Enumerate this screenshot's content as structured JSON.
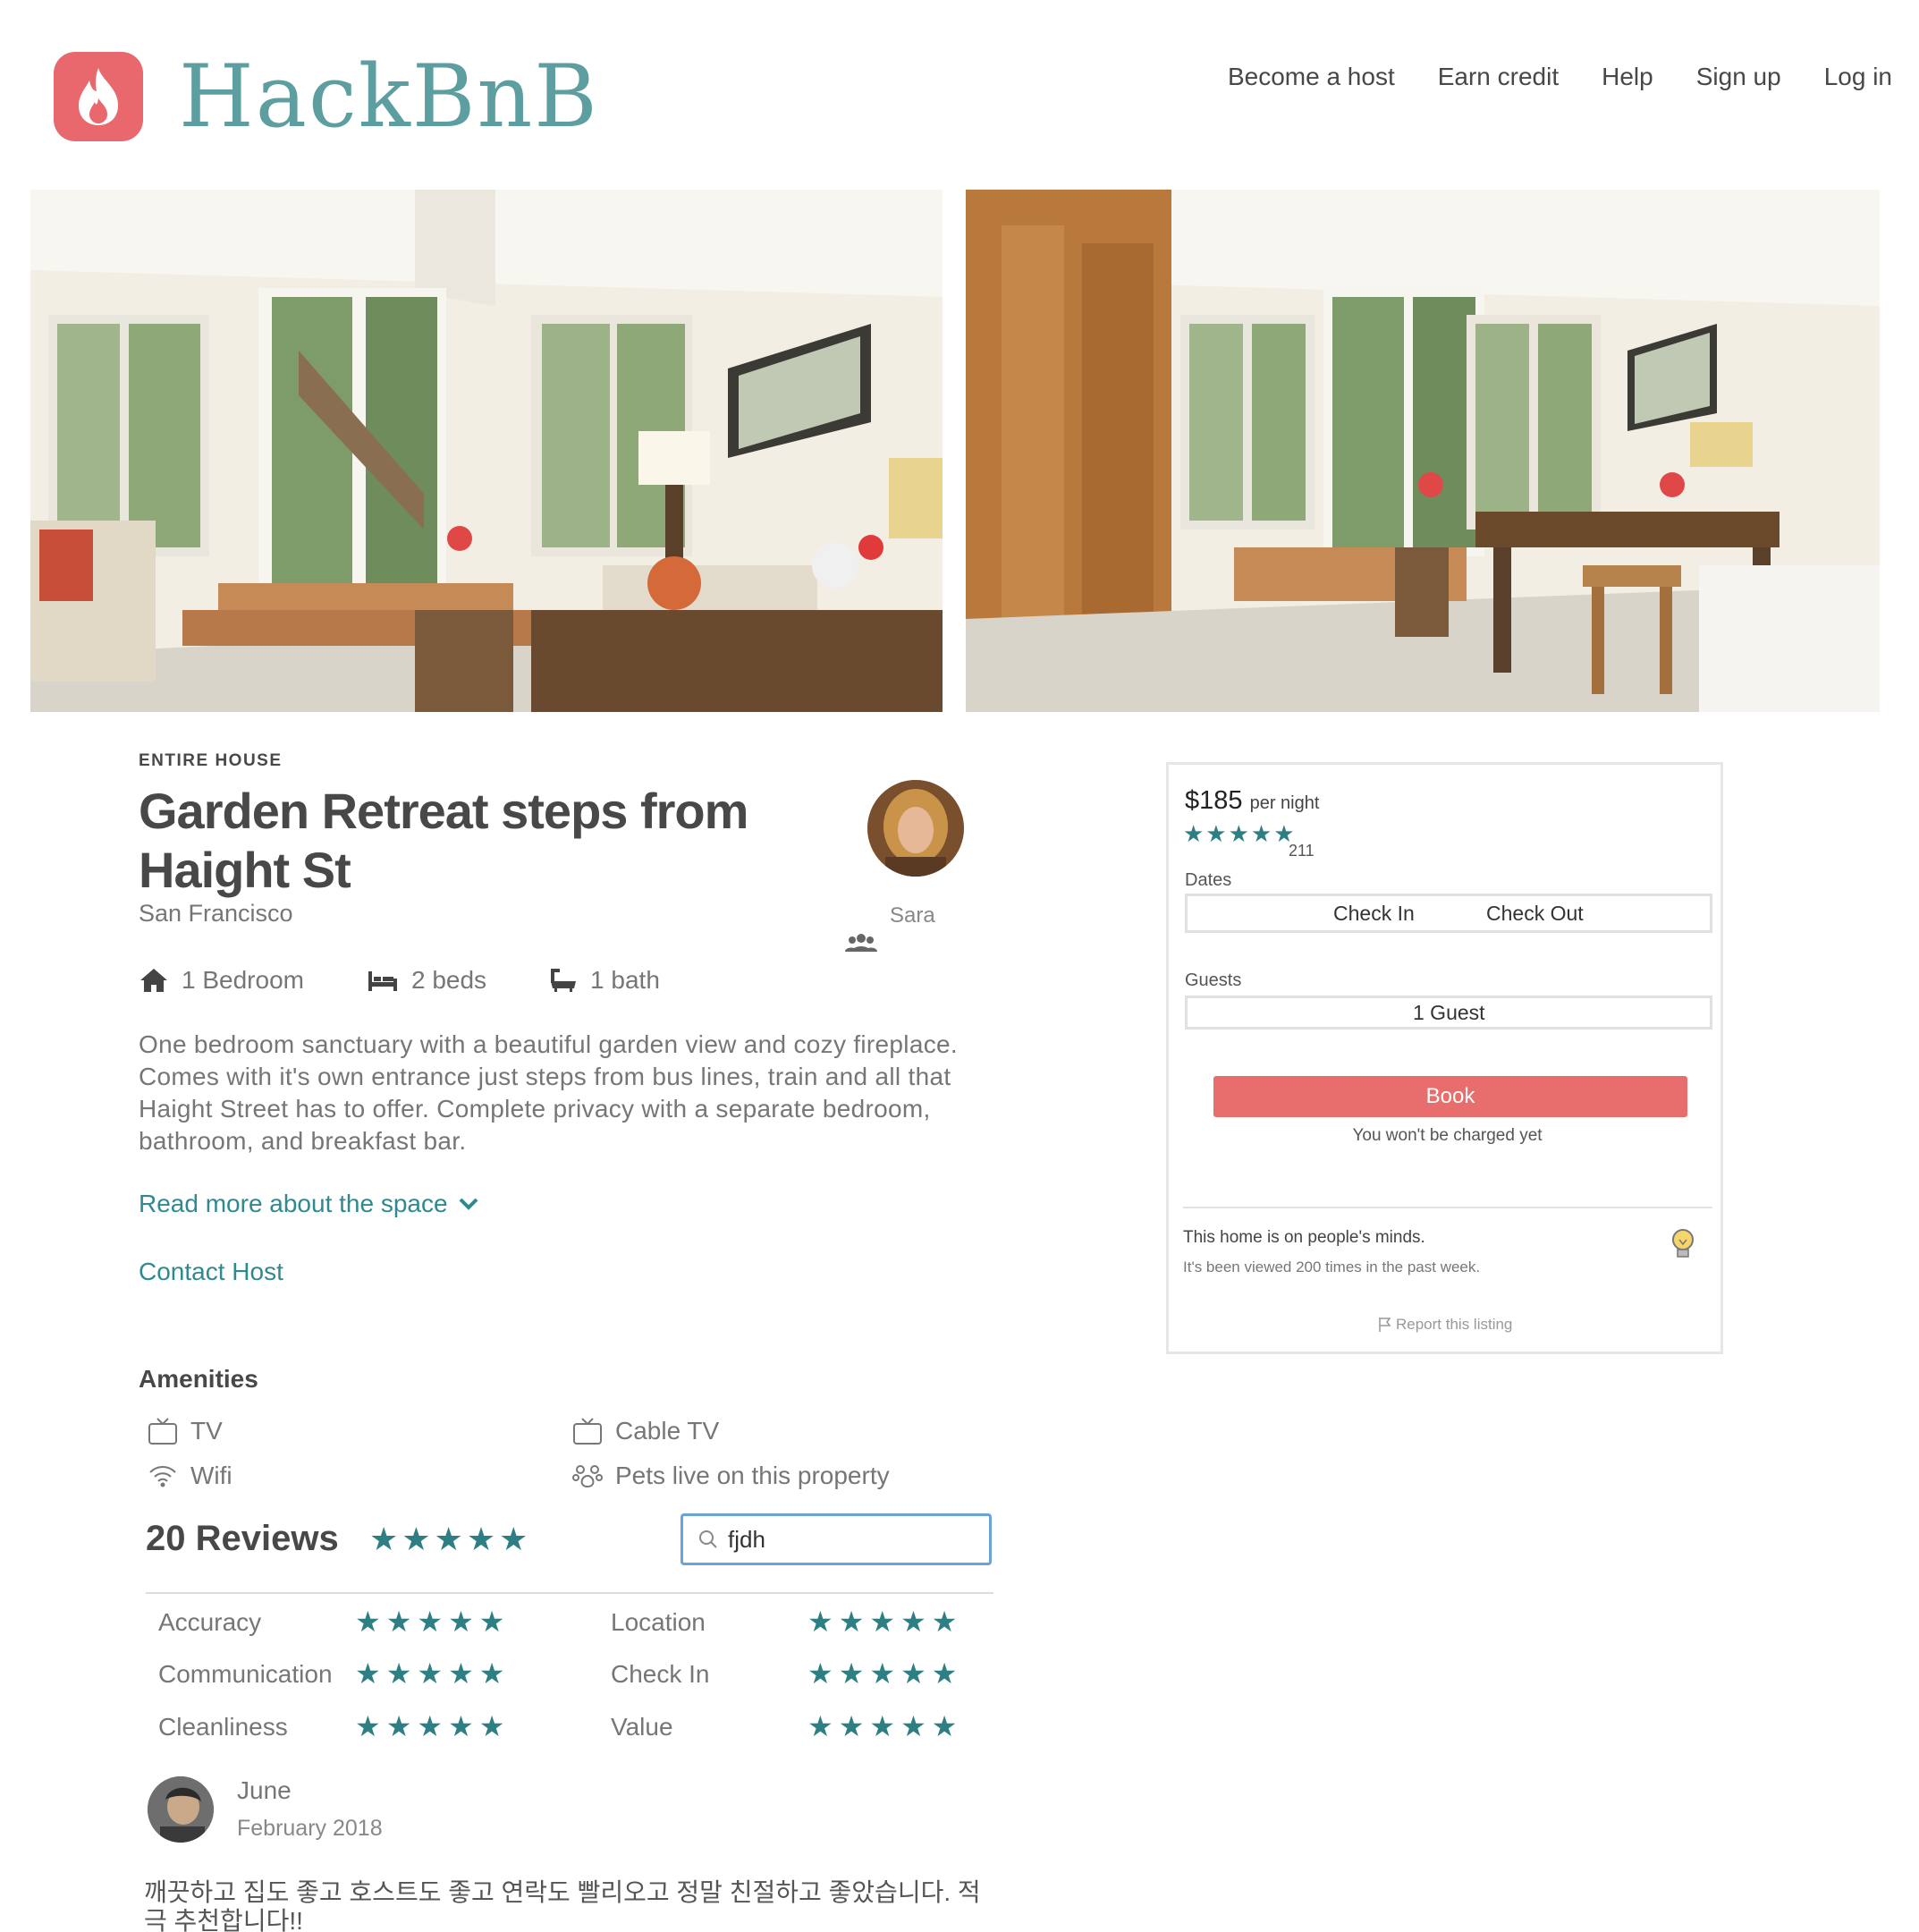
{
  "brand": {
    "name": "HackBnB",
    "color": "#e8686e",
    "text_color": "#5d9ea1"
  },
  "nav": [
    "Become a host",
    "Earn credit",
    "Help",
    "Sign up",
    "Log in"
  ],
  "listing": {
    "kicker": "ENTIRE HOUSE",
    "title": "Garden Retreat steps from Haight St",
    "city": "San Francisco",
    "host_name": "Sara",
    "specs": {
      "bedroom": "1 Bedroom",
      "beds": "2 beds",
      "bath": "1 bath"
    },
    "description": "One bedroom sanctuary with a beautiful garden view and cozy fireplace. Comes with it's own entrance just steps from bus lines, train and all that Haight Street has to offer. Complete privacy with a separate bedroom, bathroom, and breakfast bar.",
    "read_more": "Read more about the space",
    "contact": "Contact Host"
  },
  "amenities": {
    "title": "Amenities",
    "items": [
      "TV",
      "Cable TV",
      "Wifi",
      "Pets live on this property"
    ]
  },
  "reviews": {
    "heading": "20 Reviews",
    "stars": "★★★★★",
    "search_value": "fjdh",
    "categories": [
      {
        "label": "Accuracy",
        "stars": "★★★★★"
      },
      {
        "label": "Location",
        "stars": "★★★★★"
      },
      {
        "label": "Communication",
        "stars": "★★★★★"
      },
      {
        "label": "Check In",
        "stars": "★★★★★"
      },
      {
        "label": "Cleanliness",
        "stars": "★★★★★"
      },
      {
        "label": "Value",
        "stars": "★★★★★"
      }
    ],
    "first": {
      "name": "June",
      "date": "February 2018",
      "text": "깨끗하고 집도 좋고 호스트도 좋고 연락도 빨리오고 정말 친절하고 좋았습니다. 적극 추천합니다!!"
    }
  },
  "booking": {
    "price": "$185",
    "per": "per night",
    "stars": "★★★★★",
    "count": "211",
    "dates_label": "Dates",
    "check_in": "Check In",
    "check_out": "Check Out",
    "guests_label": "Guests",
    "guests_value": "1 Guest",
    "book": "Book",
    "note": "You won't be charged yet",
    "minds": "This home is on people's minds.",
    "viewed": "It's been viewed 200 times in the past week.",
    "report": "Report this listing"
  },
  "accent_color": "#2e7f84"
}
